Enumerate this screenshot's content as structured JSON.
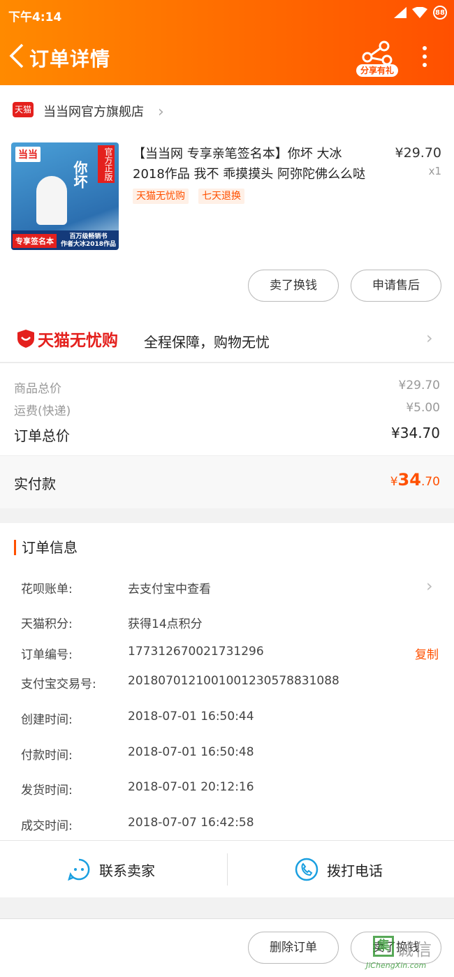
{
  "status": {
    "time": "下午4:14",
    "battery": "88"
  },
  "header": {
    "title": "订单详情",
    "share_label": "分享有礼"
  },
  "shop": {
    "badge": "天猫",
    "name": "当当网官方旗舰店"
  },
  "product": {
    "title": "【当当网 专享亲笔签名本】你坏 大冰 2018作品 我不 乖摸摸头 阿弥陀佛么么哒",
    "price": "¥29.70",
    "quantity": "x1",
    "tags": [
      "天猫无忧购",
      "七天退换"
    ],
    "cover": {
      "logo": "当当",
      "word": "你坏",
      "badge": "官方正版",
      "left_banner": "专享签名本",
      "right_banner_1": "百万级畅销书",
      "right_banner_2": "作者大冰2018作品"
    }
  },
  "actions": {
    "sell": "卖了换钱",
    "after_sale": "申请售后"
  },
  "guarantee": {
    "logo": "天猫无忧购",
    "text": "全程保障，购物无忧"
  },
  "summary": {
    "goods_label": "商品总价",
    "goods_value": "¥29.70",
    "shipping_label": "运费(快递)",
    "shipping_value": "¥5.00",
    "total_label": "订单总价",
    "total_value": "¥34.70"
  },
  "paid": {
    "label": "实付款",
    "currency": "¥",
    "int": "34",
    "dec": ".70"
  },
  "info": {
    "title": "订单信息",
    "rows": [
      {
        "label": "花呗账单:",
        "value": "去支付宝中查看"
      },
      {
        "label": "天猫积分:",
        "value": "获得14点积分"
      },
      {
        "label": "订单编号:",
        "value": "177312670021731296",
        "action": "复制"
      },
      {
        "label": "支付宝交易号:",
        "value": "2018070121001001230578831088"
      },
      {
        "label": "创建时间:",
        "value": "2018-07-01 16:50:44"
      },
      {
        "label": "付款时间:",
        "value": "2018-07-01 16:50:48"
      },
      {
        "label": "发货时间:",
        "value": "2018-07-01 20:12:16"
      },
      {
        "label": "成交时间:",
        "value": "2018-07-07 16:42:58"
      }
    ]
  },
  "contact": {
    "seller": "联系卖家",
    "phone": "拨打电话"
  },
  "bottom": {
    "delete": "删除订单",
    "sell": "卖了换钱"
  },
  "watermark": {
    "mark": "集",
    "word": "诚信",
    "url": "JiChengXin.com"
  },
  "colors": {
    "accent": "#ff5000",
    "tmall_red": "#e4201d",
    "link_blue": "#1a9fe0"
  }
}
